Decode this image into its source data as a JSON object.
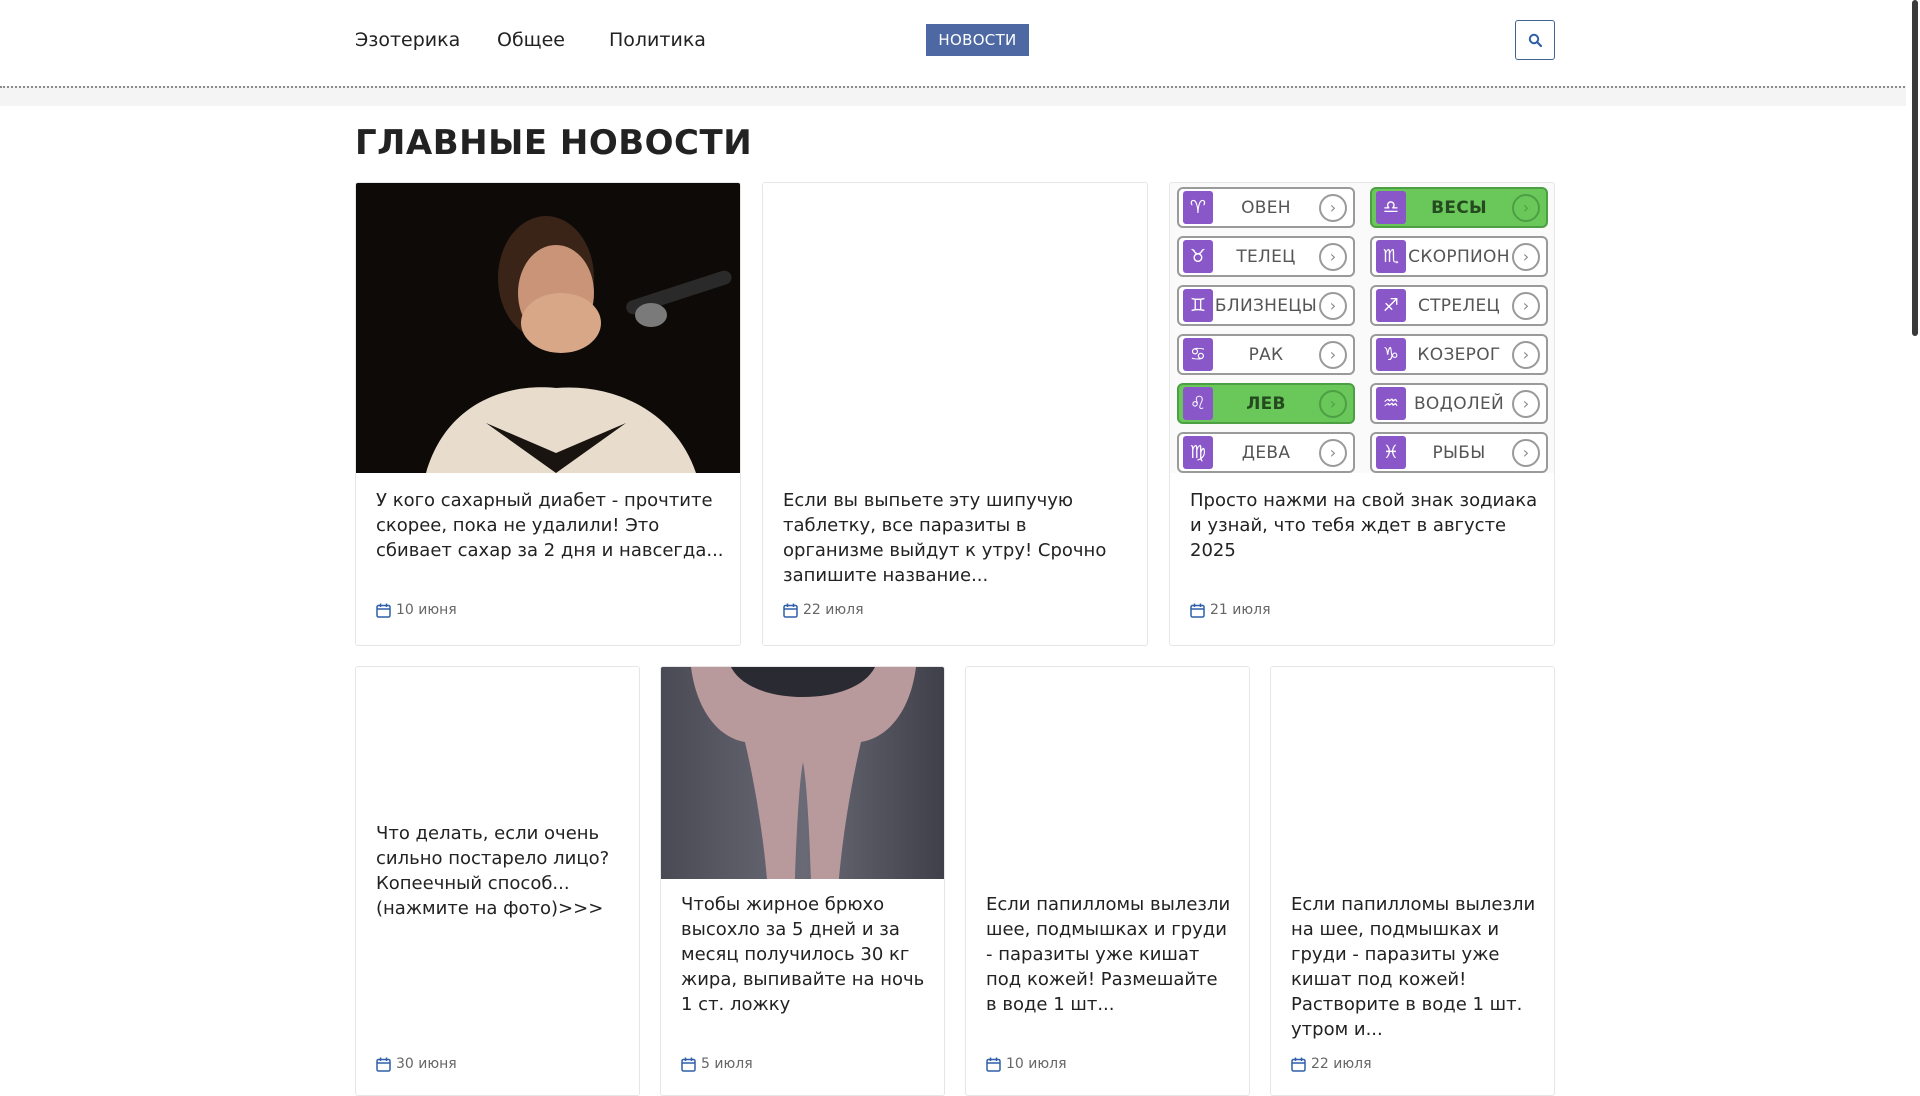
{
  "nav": {
    "items": [
      "Эзотерика",
      "Общее",
      "Политика"
    ],
    "badge": "НОВОСТИ"
  },
  "section_title": "ГЛАВНЫЕ НОВОСТИ",
  "cards_row1": [
    {
      "title": "У кого сахарный диабет - прочтите скорее, пока не удалили! Это сбивает сахар за 2 дня и навсегда...",
      "date": "10 июня"
    },
    {
      "title": "Если вы выпьете эту шипучую таблетку, все паразиты в организме выйдут к утру! Срочно запишите название...",
      "date": "22 июля"
    },
    {
      "title": "Просто нажми на свой знак зодиака и узнай, что тебя ждет в августе 2025",
      "date": "21 июля"
    }
  ],
  "zodiac": {
    "left": [
      {
        "label": "ОВЕН",
        "sym": "♈",
        "green": false
      },
      {
        "label": "ТЕЛЕЦ",
        "sym": "♉",
        "green": false
      },
      {
        "label": "БЛИЗНЕЦЫ",
        "sym": "♊",
        "green": false
      },
      {
        "label": "РАК",
        "sym": "♋",
        "green": false
      },
      {
        "label": "ЛЕВ",
        "sym": "♌",
        "green": true
      },
      {
        "label": "ДЕВА",
        "sym": "♍",
        "green": false
      }
    ],
    "right": [
      {
        "label": "ВЕСЫ",
        "sym": "♎",
        "green": true
      },
      {
        "label": "СКОРПИОН",
        "sym": "♏",
        "green": false
      },
      {
        "label": "СТРЕЛЕЦ",
        "sym": "♐",
        "green": false
      },
      {
        "label": "КОЗЕРОГ",
        "sym": "♑",
        "green": false
      },
      {
        "label": "ВОДОЛЕЙ",
        "sym": "♒",
        "green": false
      },
      {
        "label": "РЫБЫ",
        "sym": "♓",
        "green": false
      }
    ]
  },
  "cards_row2": [
    {
      "title": "Что делать, если очень сильно постарело лицо? Копеечный способ... (нажмите на фото)>>>",
      "date": "30 июня"
    },
    {
      "title": "Чтобы жирное брюхо высохло за 5 дней и за месяц получилось 30 кг жира, выпивайте на ночь 1 ст. ложку",
      "date": "5 июля"
    },
    {
      "title": "Если папилломы вылезли шее, подмышках и груди - паразиты уже кишат под кожей! Размешайте в воде 1 шт...",
      "date": "10 июля"
    },
    {
      "title": "Если папилломы вылезли на шее, подмышках и груди - паразиты уже кишат под кожей! Растворите в воде 1 шт. утром и...",
      "date": "22 июля"
    }
  ],
  "colors": {
    "accent": "#4d68a3",
    "icon_blue": "#2f5fa8",
    "zodiac_purple": "#8a57c9",
    "zodiac_green": "#6ac75a"
  }
}
